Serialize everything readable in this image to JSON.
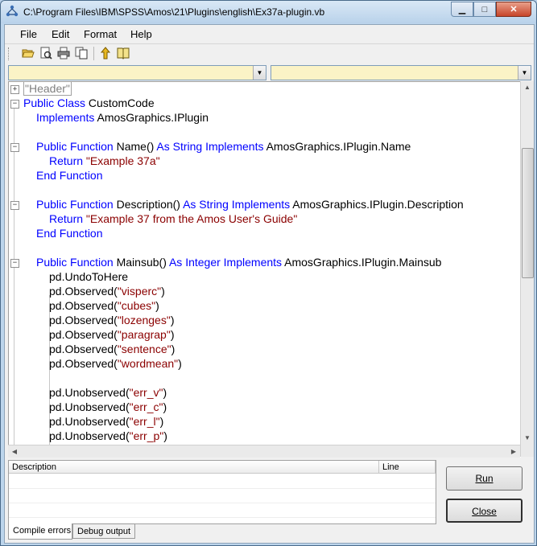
{
  "window": {
    "title": "C:\\Program Files\\IBM\\SPSS\\Amos\\21\\Plugins\\english\\Ex37a-plugin.vb",
    "minimize_glyph": "▁",
    "maximize_glyph": "□",
    "close_glyph": "✕"
  },
  "menu": {
    "file": "File",
    "edit": "Edit",
    "format": "Format",
    "help": "Help"
  },
  "toolbar": {
    "icons": [
      "open-icon",
      "print-preview-icon",
      "print-icon",
      "copy-icon",
      "up-icon",
      "help-book-icon"
    ]
  },
  "combos": {
    "left_value": "",
    "right_value": ""
  },
  "code": {
    "header": "\"Header\"",
    "l1_kw": "Public Class",
    "l1_rest": " CustomCode",
    "l2_kw": "Implements",
    "l2_rest": " AmosGraphics.IPlugin",
    "l4_kw": "Public Function",
    "l4_mid": " Name() ",
    "l4_kw2": "As String Implements",
    "l4_rest": " AmosGraphics.IPlugin.Name",
    "l5_kw": "Return",
    "l5_str": " \"Example 37a\"",
    "l6_kw": "End Function",
    "l8_kw": "Public Function",
    "l8_mid": " Description() ",
    "l8_kw2": "As String Implements",
    "l8_rest": " AmosGraphics.IPlugin.Description",
    "l9_kw": "Return",
    "l9_str": " \"Example 37 from the Amos User's Guide\"",
    "l10_kw": "End Function",
    "l12_kw": "Public Function",
    "l12_mid": " Mainsub() ",
    "l12_kw2": "As Integer Implements",
    "l12_rest": " AmosGraphics.IPlugin.Mainsub",
    "l13": "pd.UndoToHere",
    "obs_prefix": "pd.Observed(",
    "unobs_prefix": "pd.Unobserved(",
    "close_paren": ")",
    "observed": [
      "\"visperc\"",
      "\"cubes\"",
      "\"lozenges\"",
      "\"paragrap\"",
      "\"sentence\"",
      "\"wordmean\""
    ],
    "unobserved": [
      "\"err_v\"",
      "\"err_c\"",
      "\"err_l\"",
      "\"err_p\""
    ]
  },
  "colors": {
    "keyword": "#0000ff",
    "string": "#8b0000",
    "combo_bg": "#fbf3c6"
  },
  "errors_table": {
    "col_description": "Description",
    "col_line": "Line"
  },
  "tabs": {
    "compile_errors": "Compile errors",
    "debug_output": "Debug output"
  },
  "buttons": {
    "run": "Run",
    "close": "Close"
  }
}
